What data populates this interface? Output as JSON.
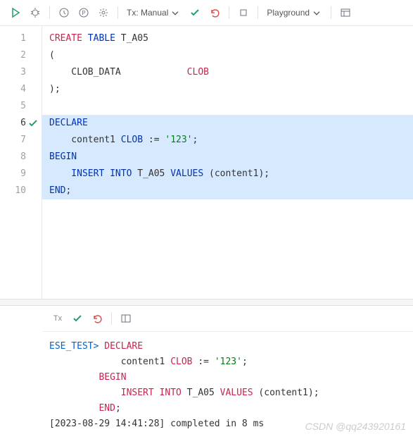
{
  "toolbar": {
    "tx_label": "Tx: Manual",
    "playground_label": "Playground"
  },
  "gutter": [
    "1",
    "2",
    "3",
    "4",
    "5",
    "6",
    "7",
    "8",
    "9",
    "10"
  ],
  "code": {
    "l1": {
      "a": "CREATE",
      "b": " TABLE",
      "c": " T_A05"
    },
    "l2": "(",
    "l3": {
      "a": "    CLOB_DATA            ",
      "b": "CLOB"
    },
    "l4": ");",
    "l5": "",
    "l6": "DECLARE",
    "l7": {
      "a": "    content1 ",
      "b": "CLOB",
      "c": " := ",
      "d": "'123'",
      "e": ";"
    },
    "l8": "BEGIN",
    "l9": {
      "a": "    INSERT",
      "b": " INTO",
      "c": " T_A05 ",
      "d": "VALUES",
      "e": " (content1);"
    },
    "l10": {
      "a": "END",
      "b": ";"
    }
  },
  "output": {
    "prompt": "ESE_TEST>",
    "l1": " DECLARE",
    "l2": {
      "a": "             content1 ",
      "b": "CLOB",
      "c": " := ",
      "d": "'123'",
      "e": ";"
    },
    "l3": {
      "a": "         ",
      "b": "BEGIN"
    },
    "l4": {
      "a": "             ",
      "b": "INSERT INTO",
      "c": " T_A05 ",
      "d": "VALUES",
      "e": " (content1);"
    },
    "l5": {
      "a": "         ",
      "b": "END",
      "c": ";"
    },
    "l6": "[2023-08-29 14:41:28] completed in 8 ms"
  },
  "watermark": "CSDN @qq243920161"
}
